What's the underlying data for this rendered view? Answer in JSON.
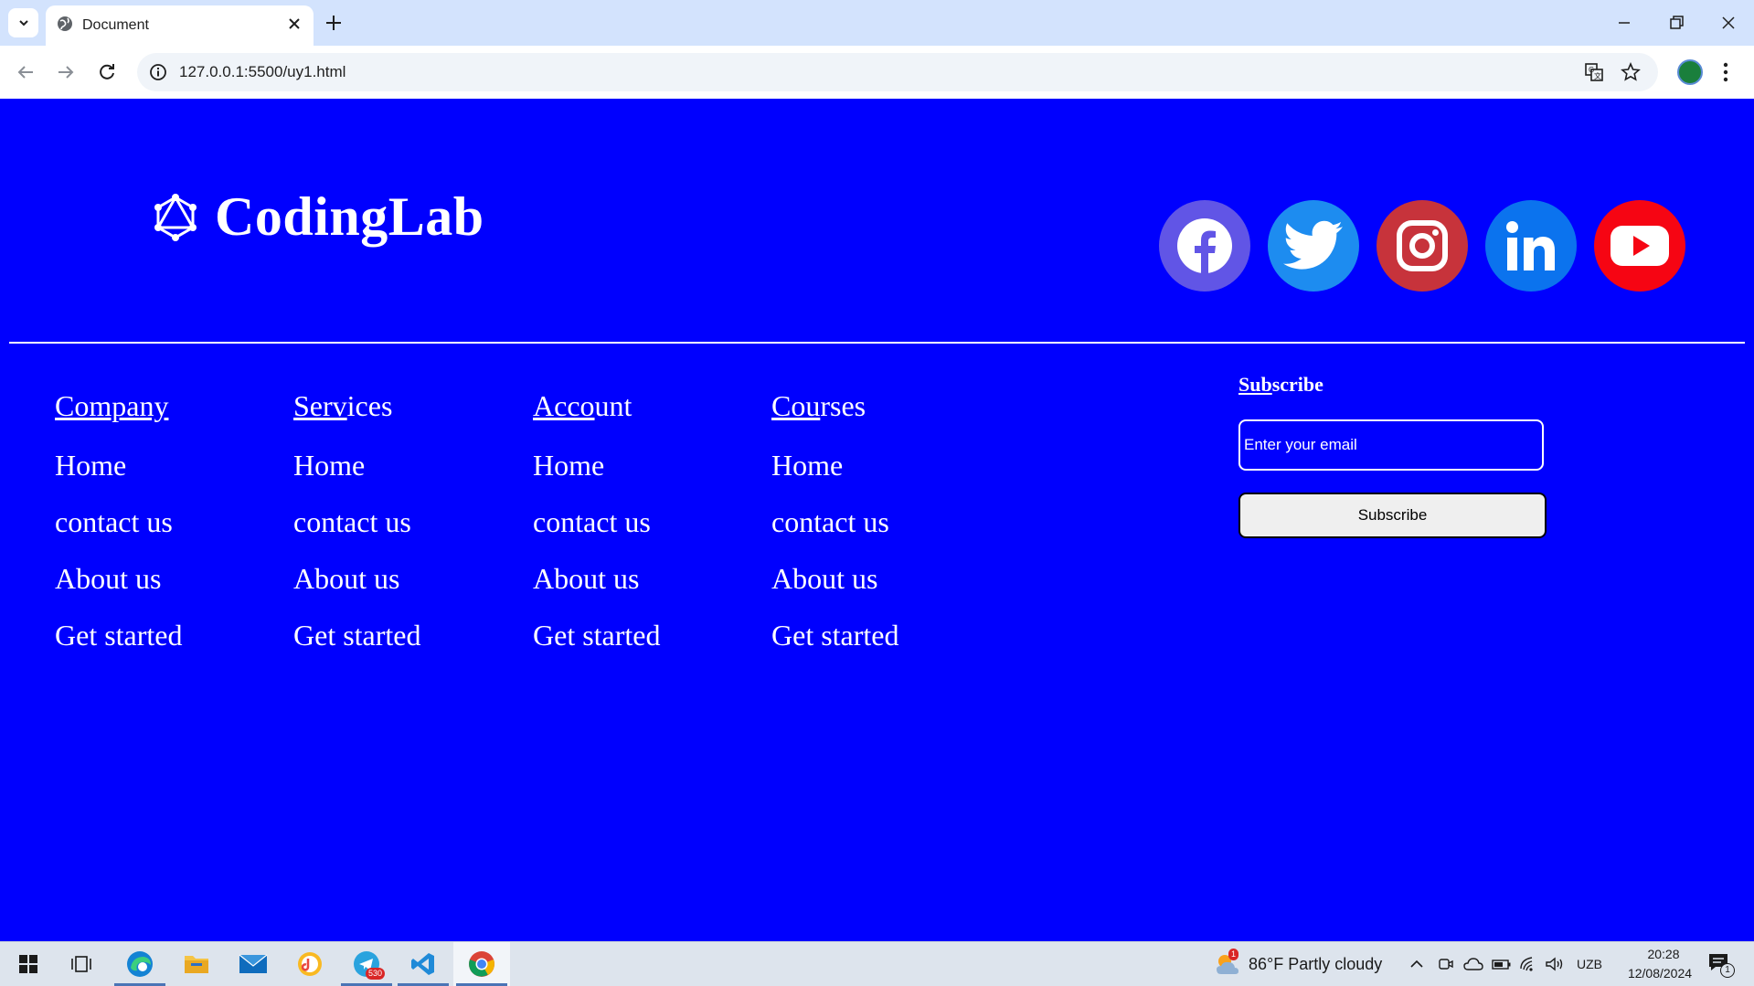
{
  "browser": {
    "tab_title": "Document",
    "url": "127.0.0.1:5500/uy1.html"
  },
  "page": {
    "logo": {
      "name": "CodingLab"
    },
    "social_icons": [
      "facebook-icon",
      "twitter-icon",
      "instagram-icon",
      "linkedin-icon",
      "youtube-icon"
    ],
    "columns": [
      {
        "head_underlined": "Company",
        "head_rest": "",
        "links": [
          "Home",
          "contact us",
          "About us",
          "Get started"
        ]
      },
      {
        "head_underlined": "Serv",
        "head_rest": "ices",
        "links": [
          "Home",
          "contact us",
          "About us",
          "Get started"
        ]
      },
      {
        "head_underlined": "Acco",
        "head_rest": "unt",
        "links": [
          "Home",
          "contact us",
          "About us",
          "Get started"
        ]
      },
      {
        "head_underlined": "Cou",
        "head_rest": "rses",
        "links": [
          "Home",
          "contact us",
          "About us",
          "Get started"
        ]
      }
    ],
    "subscribe": {
      "title_underlined": "Sub",
      "title_rest": "scribe",
      "email_placeholder": "Enter your email",
      "button_label": "Subscribe"
    }
  },
  "taskbar": {
    "weather": "86°F  Partly cloudy",
    "weather_badge": "1",
    "telegram_badge": "530",
    "language": "UZB",
    "time": "20:28",
    "date": "12/08/2024",
    "notification_count": "1"
  },
  "colors": {
    "page_background": "#0000fe",
    "facebook": "#6155e6",
    "twitter": "#1d8cf0",
    "instagram": "#c7333b",
    "linkedin": "#0b73ee",
    "youtube": "#f60513"
  }
}
